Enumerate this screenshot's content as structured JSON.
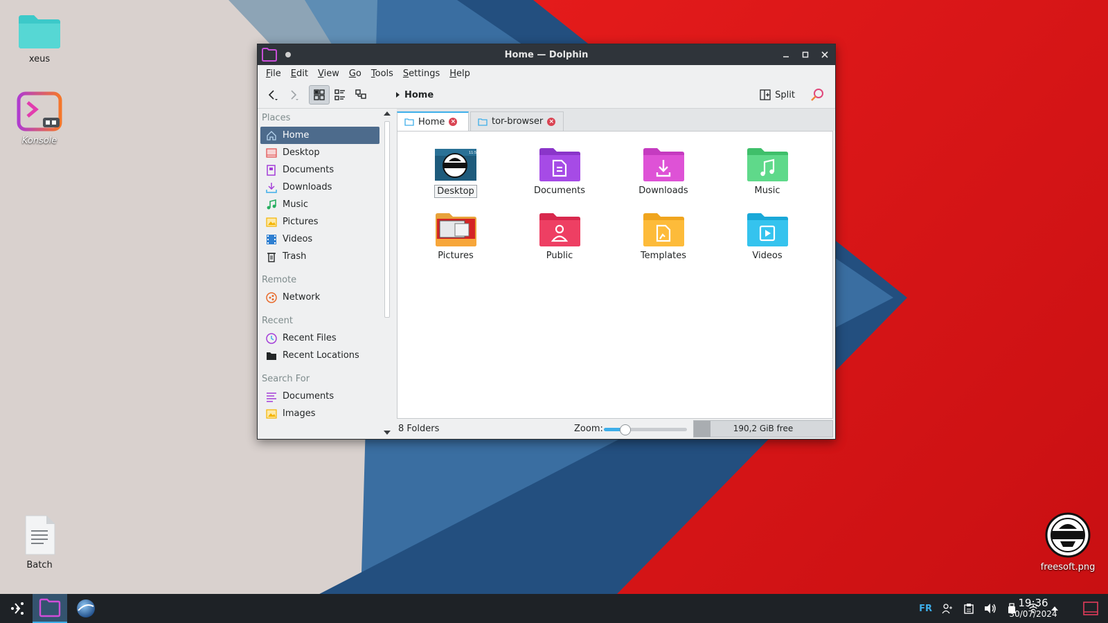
{
  "colors": {
    "accent": "#3daee9",
    "selection": "#4d6b8c",
    "tab_close": "#da4453",
    "keyboard_layout": "#3daee9"
  },
  "desktop": {
    "icons": [
      {
        "label": "xeus",
        "icon": "folder-icon"
      },
      {
        "label": "Konsole",
        "icon": "konsole-icon"
      },
      {
        "label": "Batch",
        "icon": "text-file-icon"
      },
      {
        "label": "freesoft.png",
        "icon": "image-file-icon"
      }
    ]
  },
  "window": {
    "title": "Home — Dolphin",
    "menu": [
      {
        "label": "File",
        "accel": "F",
        "rest": "ile"
      },
      {
        "label": "Edit",
        "accel": "E",
        "rest": "dit"
      },
      {
        "label": "View",
        "accel": "V",
        "rest": "iew"
      },
      {
        "label": "Go",
        "accel": "G",
        "rest": "o"
      },
      {
        "label": "Tools",
        "accel": "T",
        "rest": "ools"
      },
      {
        "label": "Settings",
        "accel": "S",
        "rest": "ettings"
      },
      {
        "label": "Help",
        "accel": "H",
        "rest": "elp"
      }
    ],
    "toolbar": {
      "breadcrumb": "Home",
      "split_label": "Split"
    },
    "sidebar": {
      "places_title": "Places",
      "places": [
        {
          "label": "Home",
          "icon": "home-icon",
          "selected": true
        },
        {
          "label": "Desktop",
          "icon": "desktop-icon"
        },
        {
          "label": "Documents",
          "icon": "documents-icon"
        },
        {
          "label": "Downloads",
          "icon": "downloads-icon"
        },
        {
          "label": "Music",
          "icon": "music-icon"
        },
        {
          "label": "Pictures",
          "icon": "pictures-icon"
        },
        {
          "label": "Videos",
          "icon": "videos-icon"
        },
        {
          "label": "Trash",
          "icon": "trash-icon"
        }
      ],
      "remote_title": "Remote",
      "remote": [
        {
          "label": "Network",
          "icon": "network-icon"
        }
      ],
      "recent_title": "Recent",
      "recent": [
        {
          "label": "Recent Files",
          "icon": "recent-files-icon"
        },
        {
          "label": "Recent Locations",
          "icon": "recent-locations-icon"
        }
      ],
      "search_title": "Search For",
      "search": [
        {
          "label": "Documents",
          "icon": "search-documents-icon"
        },
        {
          "label": "Images",
          "icon": "search-images-icon"
        }
      ]
    },
    "tabs": [
      {
        "label": "Home",
        "active": true
      },
      {
        "label": "tor-browser",
        "active": false
      }
    ],
    "items": [
      {
        "label": "Desktop",
        "icon": "desktop-folder-thumbnail",
        "selected": true
      },
      {
        "label": "Documents",
        "icon": "documents-folder-icon"
      },
      {
        "label": "Downloads",
        "icon": "downloads-folder-icon"
      },
      {
        "label": "Music",
        "icon": "music-folder-icon"
      },
      {
        "label": "Pictures",
        "icon": "pictures-folder-thumbnail"
      },
      {
        "label": "Public",
        "icon": "public-folder-icon"
      },
      {
        "label": "Templates",
        "icon": "templates-folder-icon"
      },
      {
        "label": "Videos",
        "icon": "videos-folder-icon"
      }
    ],
    "status": {
      "summary": "8 Folders",
      "zoom_label": "Zoom:",
      "zoom_level": 0.25,
      "free_space": "190,2 GiB free",
      "used_fraction": 0.12
    }
  },
  "taskbar": {
    "keyboard_layout": "FR",
    "time": "19:36",
    "date": "30/07/2024"
  }
}
